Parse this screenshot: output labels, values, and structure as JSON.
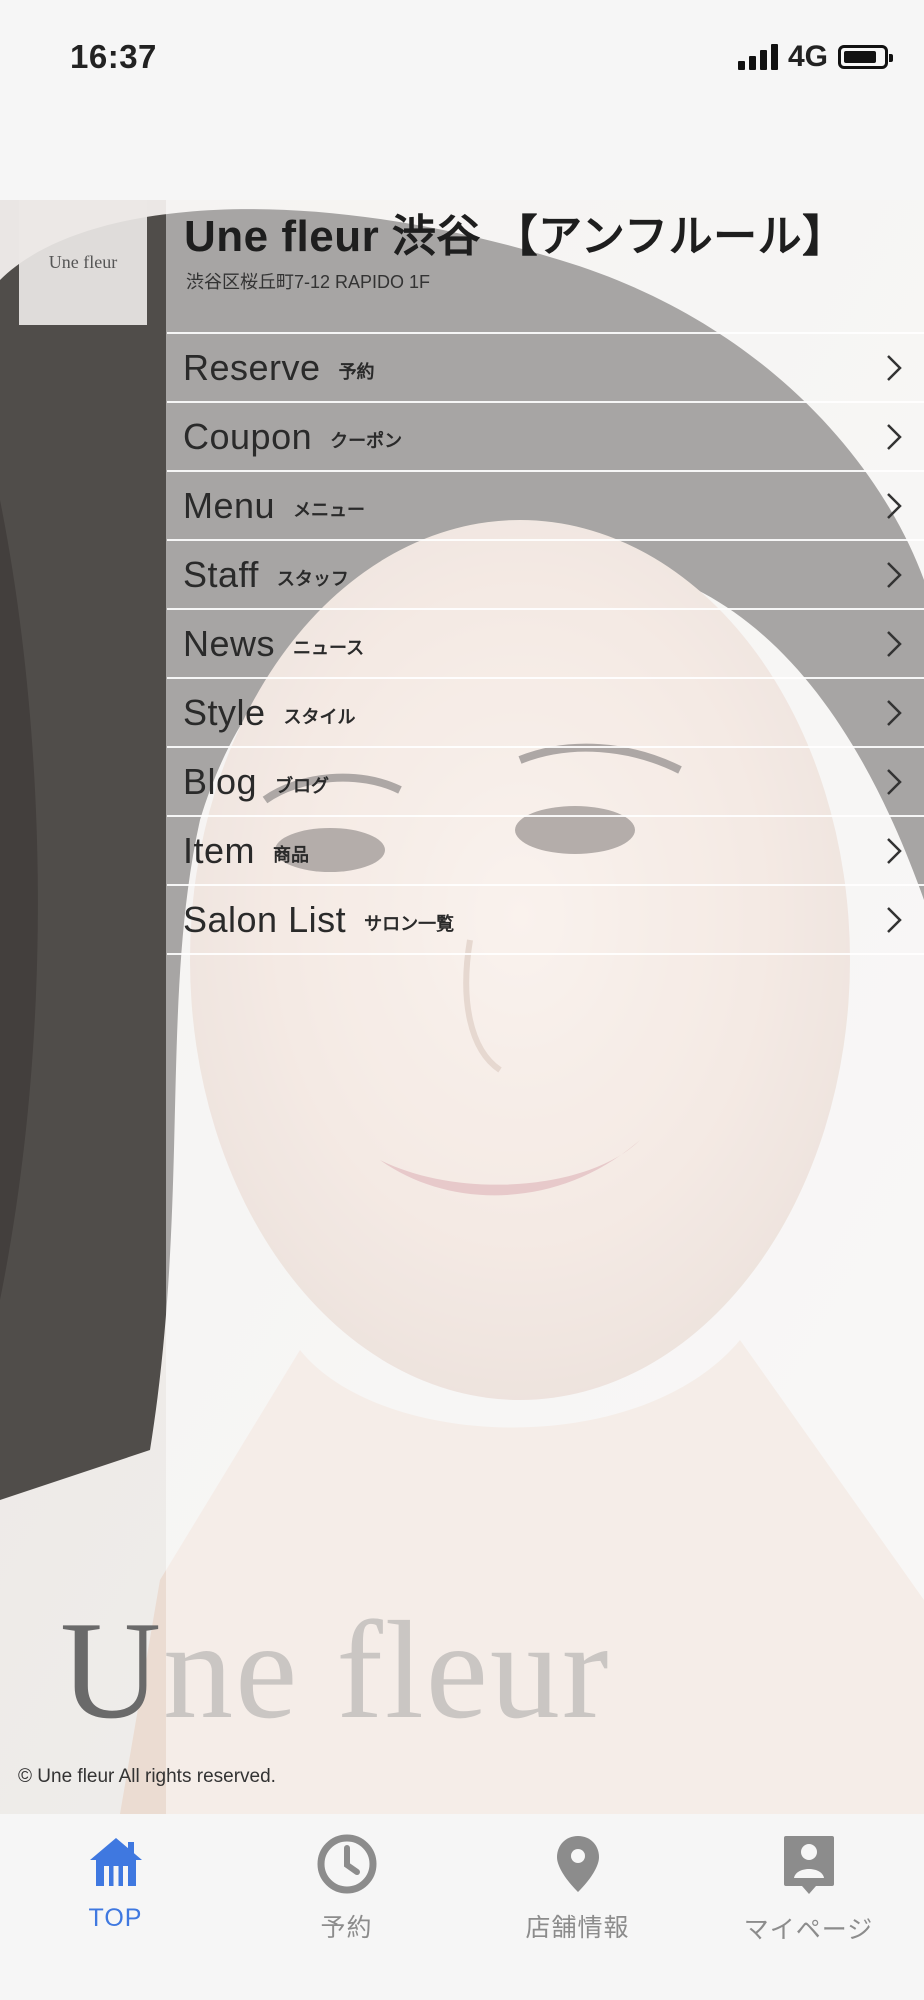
{
  "status_bar": {
    "time": "16:37",
    "network": "4G"
  },
  "salon": {
    "logo_text": "Une fleur",
    "name": "Une fleur 渋谷 【アンフルール】",
    "address": "渋谷区桜丘町7-12 RAPIDO 1F"
  },
  "menu": [
    {
      "en": "Reserve",
      "jp": "予約"
    },
    {
      "en": "Coupon",
      "jp": "クーポン"
    },
    {
      "en": "Menu",
      "jp": "メニュー"
    },
    {
      "en": "Staff",
      "jp": "スタッフ"
    },
    {
      "en": "News",
      "jp": "ニュース"
    },
    {
      "en": "Style",
      "jp": "スタイル"
    },
    {
      "en": "Blog",
      "jp": "ブログ"
    },
    {
      "en": "Item",
      "jp": "商品"
    },
    {
      "en": "Salon List",
      "jp": "サロン一覧"
    }
  ],
  "watermark": {
    "first": "U",
    "rest": "ne fleur"
  },
  "copyright": "© Une fleur All rights reserved.",
  "tabs": [
    {
      "label": "TOP",
      "icon": "home-icon",
      "active": true
    },
    {
      "label": "予約",
      "icon": "clock-icon",
      "active": false
    },
    {
      "label": "店舗情報",
      "icon": "location-pin-icon",
      "active": false
    },
    {
      "label": "マイページ",
      "icon": "profile-icon",
      "active": false
    }
  ],
  "colors": {
    "accent": "#3f78e0",
    "inactive": "#8c8c8c",
    "background": "#f6f6f6"
  }
}
